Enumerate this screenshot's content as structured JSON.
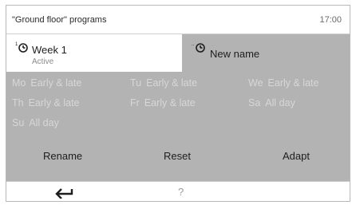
{
  "header": {
    "title": "\"Ground floor\" programs",
    "time": "17:00"
  },
  "tabs": [
    {
      "label": "Week 1",
      "status": "Active",
      "icon": "clock-icon"
    },
    {
      "label": "New name",
      "icon": "clock-icon"
    }
  ],
  "schedule": [
    {
      "day": "Mo",
      "value": "Early & late"
    },
    {
      "day": "Tu",
      "value": "Early & late"
    },
    {
      "day": "We",
      "value": "Early & late"
    },
    {
      "day": "Th",
      "value": "Early & late"
    },
    {
      "day": "Fr",
      "value": "Early & late"
    },
    {
      "day": "Sa",
      "value": "All day"
    },
    {
      "day": "Su",
      "value": "All day"
    }
  ],
  "actions": {
    "rename": "Rename",
    "reset": "Reset",
    "adapt": "Adapt"
  },
  "footer": {
    "back_icon": "back-arrow-icon",
    "help": "?"
  },
  "colors": {
    "panel": "#b3b3b3",
    "muted_text": "#d7d7d7",
    "text": "#1e1e1e"
  }
}
